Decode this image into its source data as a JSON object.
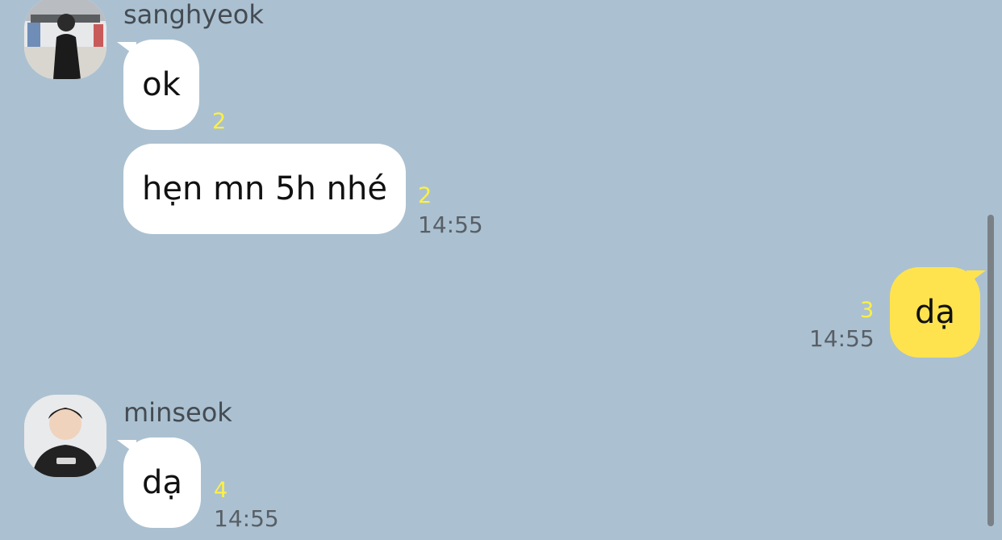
{
  "colors": {
    "background": "#abc1d1",
    "incoming_bubble": "#ffffff",
    "outgoing_bubble": "#fee34f",
    "unread_count": "#fef043",
    "timestamp": "#585f66",
    "sender_name": "#444b52"
  },
  "messages": [
    {
      "sender": "sanghyeok",
      "avatar_icon": "profile-photo",
      "lines": [
        {
          "text": "ok",
          "unread": "2",
          "time": ""
        },
        {
          "text": "hẹn mn 5h nhé",
          "unread": "2",
          "time": "14:55"
        }
      ]
    },
    {
      "sender": "me",
      "lines": [
        {
          "text": "dạ",
          "unread": "3",
          "time": "14:55"
        }
      ]
    },
    {
      "sender": "minseok",
      "avatar_icon": "profile-photo",
      "lines": [
        {
          "text": "dạ",
          "unread": "4",
          "time": "14:55"
        }
      ]
    }
  ]
}
